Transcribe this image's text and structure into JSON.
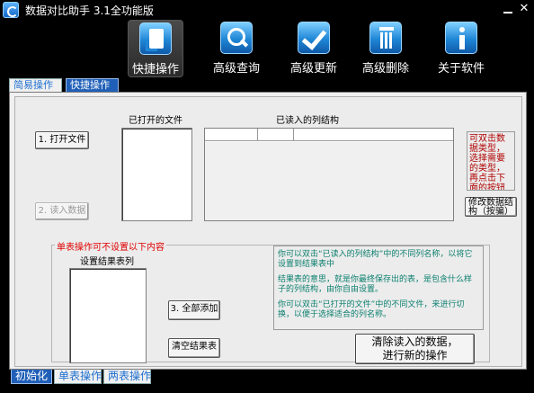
{
  "window": {
    "title": "数据对比助手 3.1全功能版",
    "minimize_label": "",
    "close_label": "✕"
  },
  "toolbar": {
    "items": [
      {
        "label": "快捷操作",
        "icon": "document-import-icon",
        "active": true
      },
      {
        "label": "高级查询",
        "icon": "search-icon",
        "active": false
      },
      {
        "label": "高级更新",
        "icon": "checkmark-icon",
        "active": false
      },
      {
        "label": "高级删除",
        "icon": "trash-icon",
        "active": false
      },
      {
        "label": "关于软件",
        "icon": "info-icon",
        "active": false
      }
    ]
  },
  "top_tabs": [
    {
      "label": "简易操作",
      "active": false
    },
    {
      "label": "快捷操作",
      "active": true
    }
  ],
  "files": {
    "open_button": "1. 打开文件",
    "read_button": "2. 读入数据",
    "opened_files_label": "已打开的文件",
    "columns_label": "已读入的列结构"
  },
  "hint_red": "可双击数据类型，选择需要的类型，再点击下面的按钮修改",
  "modify_button": "修改数据结构（按骗）",
  "single_table": {
    "group_title": "单表操作可不设置以下内容",
    "result_list_label": "设置结果表列",
    "add_all_button": "3. 全部添加",
    "clear_button": "清空结果表"
  },
  "info": {
    "p1": "你可以双击“已读入的列结构”中的不同列名称，以将它设置到结果表中",
    "p2": "结果表的意思，就是你最终保存出的表，是包含什么样子的列结构，由你自由设置。",
    "p3": "你可以双击“已打开的文件”中的不同文件，来进行切换，以便于选择适合的列名称。"
  },
  "clear_data_button": {
    "line1": "清除读入的数据，",
    "line2": "进行新的操作"
  },
  "bottom_tabs": [
    {
      "label": "初始化",
      "active": true
    },
    {
      "label": "单表操作",
      "active": false
    },
    {
      "label": "两表操作",
      "active": false
    }
  ],
  "colors": {
    "background": "#000000",
    "panel": "#f0f0f0",
    "active_tab": "#1f5fb8",
    "hint_red": "#b00000",
    "group_title_red": "#e00000",
    "info_teal": "#0a7f6e"
  }
}
